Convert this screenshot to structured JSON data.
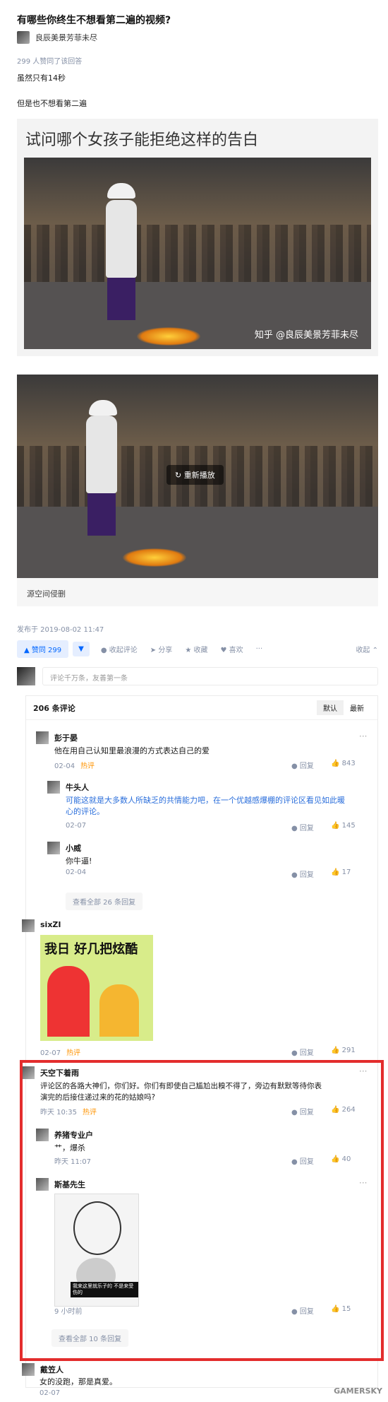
{
  "question": {
    "title": "有哪些你终生不想看第二遍的视频?"
  },
  "answer": {
    "author": "良辰美景芳菲未尽",
    "votes_summary": "299 人赞同了该回答",
    "paragraphs": [
      "虽然只有14秒",
      "但是也不想看第二遍"
    ],
    "image_caption": "试问哪个女孩子能拒绝这样的告白",
    "watermark": "知乎 @良辰美景芳菲未尽",
    "video_replay": "重新播放",
    "video_source": "源空间侵删",
    "published": "发布于 2019-08-02 11:47"
  },
  "actions": {
    "upvote": "赞同 299",
    "comments": "收起评论",
    "share": "分享",
    "favorite": "收藏",
    "like": "喜欢",
    "more": "···",
    "collapse": "收起"
  },
  "comment_input": {
    "placeholder": "评论千万条，友善第一条"
  },
  "comments_panel": {
    "count": "206 条评论",
    "sort_default": "默认",
    "sort_latest": "最新",
    "reply_label": "回复",
    "dots": "···",
    "items": [
      {
        "name": "彭于晏",
        "text": "他在用自己认知里最浪漫的方式表达自己的爱",
        "date": "02-04",
        "hot": "热评",
        "likes": "843"
      },
      {
        "name": "牛头人",
        "text": "可能这就是大多数人所缺乏的共情能力吧，在一个优越感爆棚的评论区看见如此暖",
        "text2": "心的评论。",
        "date": "02-07",
        "likes": "145"
      },
      {
        "name": "小威",
        "text": "你牛逼!",
        "date": "02-04",
        "likes": "17"
      },
      {
        "name": "sixZI",
        "meme_text": "我日 好几把炫酷",
        "date": "02-07",
        "hot": "热评",
        "likes": "291"
      },
      {
        "name": "天空下着雨",
        "text": "评论区的各路大神们，你们好。你们有即使自己尴尬出糗不得了，旁边有默默等待你表",
        "text2": "演完的后接住递过来的花的姑娘吗?",
        "date": "昨天 10:35",
        "hot": "热评",
        "likes": "264"
      },
      {
        "name": "养猪专业户",
        "text": "艹，爆杀",
        "date": "昨天 11:07",
        "likes": "40"
      },
      {
        "name": "斯基先生",
        "meme_caption": "我来这里就乐子的 不是来受伤的",
        "date": "9 小时前",
        "likes": "15"
      },
      {
        "name": "戴笠人",
        "text": "女的没跑，那是真爱。",
        "date": "02-07"
      }
    ],
    "view_all_1": "查看全部 26 条回复",
    "view_all_2": "查看全部 10 条回复"
  },
  "footer_watermark": "GAMERSKY",
  "colors": {
    "accent": "#0066ff",
    "hot": "#ff9607",
    "highlight_box": "#e32d2d"
  }
}
